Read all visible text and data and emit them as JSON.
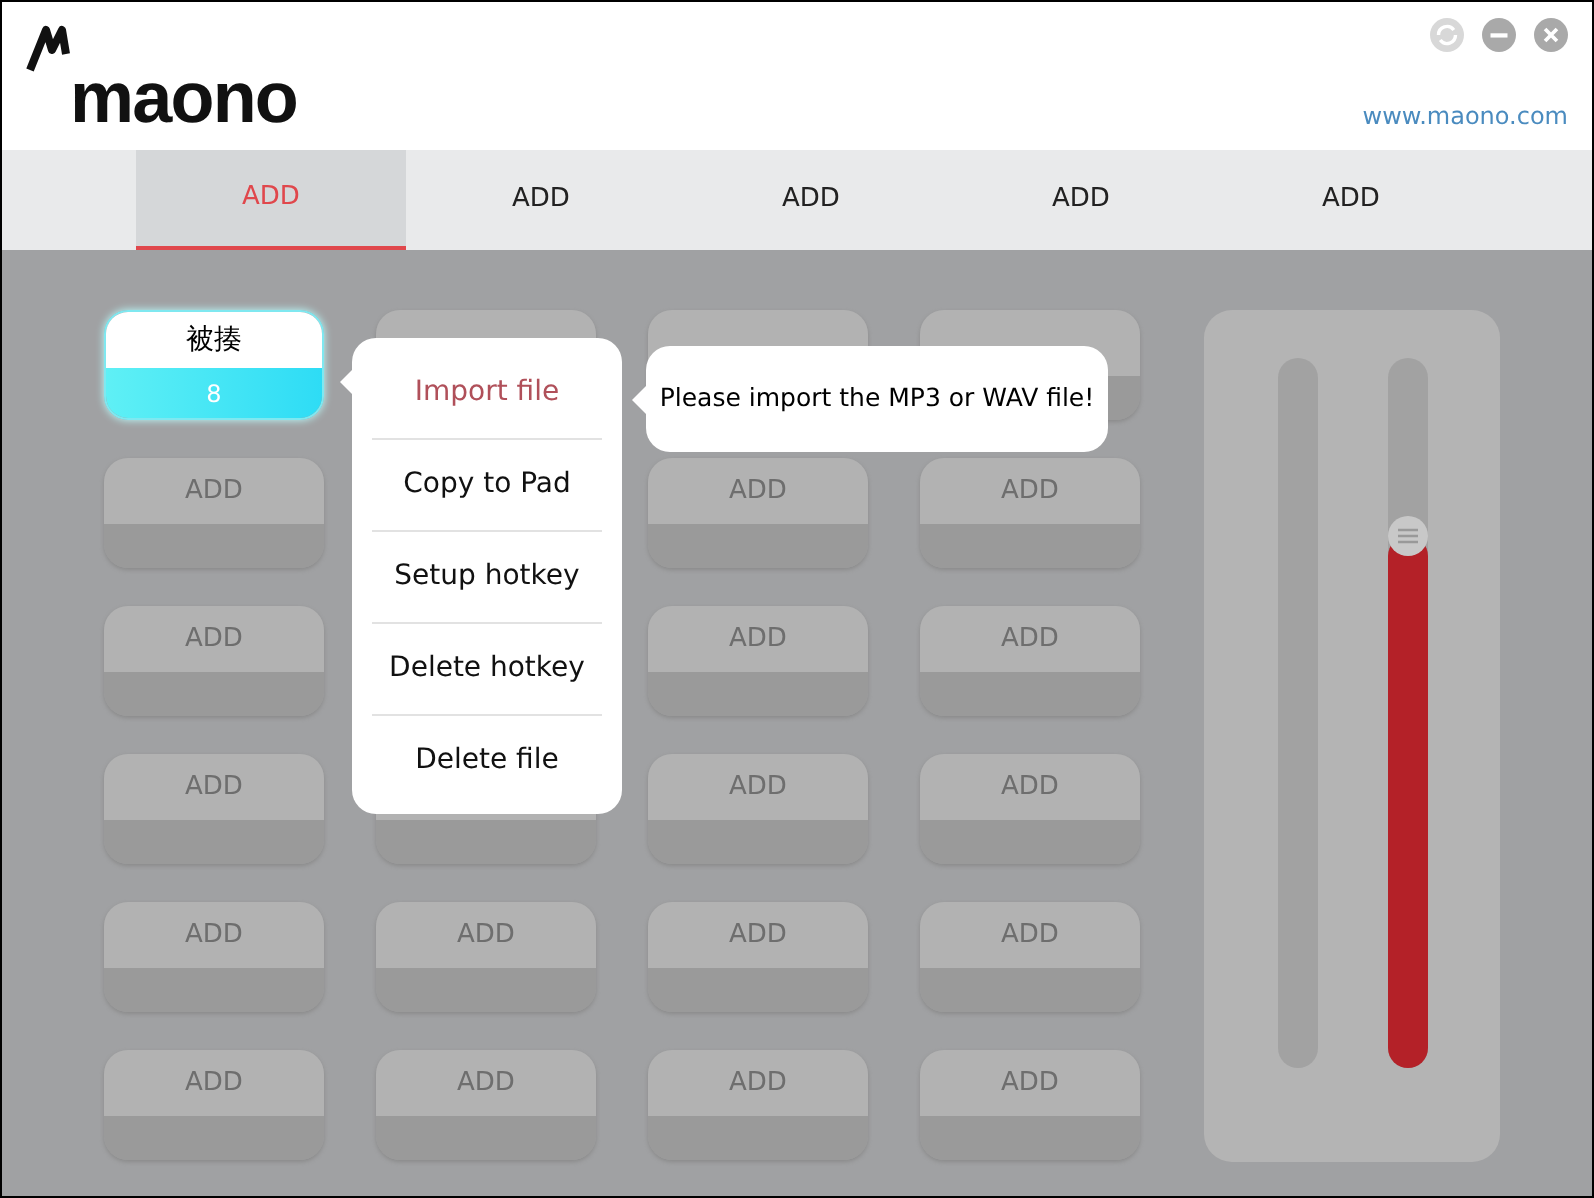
{
  "logo": "maono",
  "website": "www.maono.com",
  "tabs": [
    {
      "label": "ADD",
      "selected": true
    },
    {
      "label": "ADD",
      "selected": false
    },
    {
      "label": "ADD",
      "selected": false
    },
    {
      "label": "ADD",
      "selected": false
    },
    {
      "label": "ADD",
      "selected": false
    }
  ],
  "pads": [
    {
      "label": "被揍",
      "sub": "8",
      "selected": true
    },
    {
      "label": "ADD",
      "selected": false
    },
    {
      "label": "ADD",
      "selected": false
    },
    {
      "label": "ADD",
      "selected": false
    },
    {
      "label": "ADD",
      "selected": false
    },
    {
      "label": "ADD",
      "selected": false
    },
    {
      "label": "ADD",
      "selected": false
    },
    {
      "label": "ADD",
      "selected": false
    },
    {
      "label": "ADD",
      "selected": false
    },
    {
      "label": "ADD",
      "selected": false
    },
    {
      "label": "ADD",
      "selected": false
    },
    {
      "label": "ADD",
      "selected": false
    },
    {
      "label": "ADD",
      "selected": false
    },
    {
      "label": "ADD",
      "selected": false
    },
    {
      "label": "ADD",
      "selected": false
    },
    {
      "label": "ADD",
      "selected": false
    },
    {
      "label": "ADD",
      "selected": false
    },
    {
      "label": "ADD",
      "selected": false
    }
  ],
  "context_menu": {
    "items": [
      {
        "label": "Import file",
        "highlighted": true
      },
      {
        "label": "Copy to Pad",
        "highlighted": false
      },
      {
        "label": "Setup hotkey",
        "highlighted": false
      },
      {
        "label": "Delete hotkey",
        "highlighted": false
      },
      {
        "label": "Delete file",
        "highlighted": false
      }
    ]
  },
  "tooltip": {
    "text": "Please import the MP3 or WAV file!"
  },
  "meters": [
    {
      "kind": "meter"
    },
    {
      "kind": "slider",
      "level": 0.75
    }
  ]
}
